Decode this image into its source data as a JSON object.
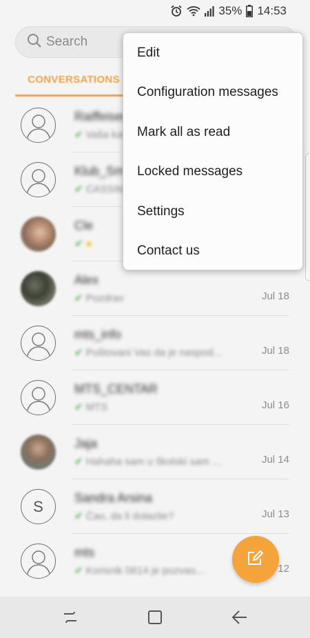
{
  "status_bar": {
    "battery_percent": "35%",
    "time": "14:53",
    "icons": [
      "alarm-icon",
      "wifi-icon",
      "signal-icon",
      "battery-icon"
    ]
  },
  "search": {
    "placeholder": "Search"
  },
  "tabs": [
    {
      "label": "CONVERSATIONS",
      "active": true
    }
  ],
  "conversations": [
    {
      "name": "Raiffeisen",
      "snippet": "Vaša kartica...",
      "date": "",
      "avatar": "default"
    },
    {
      "name": "Klub_Sm",
      "snippet": "CASSIMO...",
      "date": "",
      "avatar": "default"
    },
    {
      "name": "Cle",
      "snippet": "",
      "date": "",
      "avatar": "photo"
    },
    {
      "name": "Alex",
      "snippet": "Pozdrav",
      "date": "Jul 18",
      "avatar": "photo"
    },
    {
      "name": "mts_info",
      "snippet": "Poštovani Vas da je naspod...",
      "date": "Jul 18",
      "avatar": "default"
    },
    {
      "name": "MTS_CENTAR",
      "snippet": "MTS",
      "date": "Jul 16",
      "avatar": "default"
    },
    {
      "name": "Jaja",
      "snippet": "Hahaha sam u školski sam ...",
      "date": "Jul 14",
      "avatar": "photo"
    },
    {
      "name": "Sandra Arsina",
      "snippet": "Ćao, da li dolazite?",
      "date": "Jul 13",
      "avatar": "letter",
      "letter": "S"
    },
    {
      "name": "mts",
      "snippet": "Korisnik 0614 je pozvao...",
      "date": "Jul 12",
      "avatar": "default"
    }
  ],
  "menu": {
    "items": [
      "Edit",
      "Configuration messages",
      "Mark all as read",
      "Locked messages",
      "Settings",
      "Contact us"
    ]
  },
  "colors": {
    "accent": "#f0a24a",
    "fab": "#f5a33b",
    "check": "#47b04b"
  }
}
